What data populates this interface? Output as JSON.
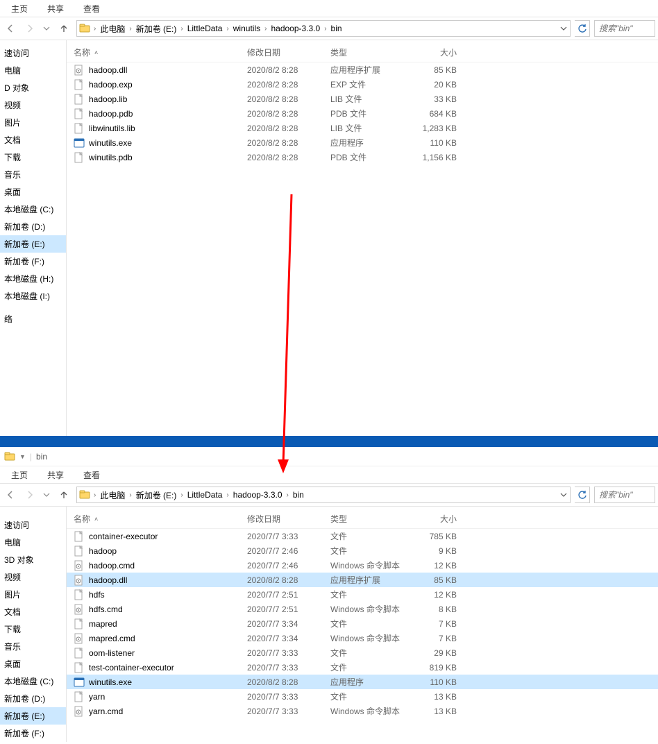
{
  "tabs": {
    "home": "主页",
    "share": "共享",
    "view": "查看"
  },
  "breadcrumb1": [
    "此电脑",
    "新加卷 (E:)",
    "LittleData",
    "winutils",
    "hadoop-3.3.0",
    "bin"
  ],
  "breadcrumb2": [
    "此电脑",
    "新加卷 (E:)",
    "LittleData",
    "hadoop-3.3.0",
    "bin"
  ],
  "search_placeholder": "搜索\"bin\"",
  "columns": {
    "name": "名称",
    "date": "修改日期",
    "type": "类型",
    "size": "大小"
  },
  "sidebar1": [
    "速访问",
    "电脑",
    "D 对象",
    "视频",
    "图片",
    "文档",
    "下载",
    "音乐",
    "桌面",
    "本地磁盘 (C:)",
    "新加卷 (D:)",
    "新加卷 (E:)",
    "新加卷 (F:)",
    "本地磁盘 (H:)",
    "本地磁盘 (I:)",
    "",
    "络"
  ],
  "sidebar1_selected": 11,
  "files1": [
    {
      "icon": "dll",
      "name": "hadoop.dll",
      "date": "2020/8/2 8:28",
      "type": "应用程序扩展",
      "size": "85 KB"
    },
    {
      "icon": "file",
      "name": "hadoop.exp",
      "date": "2020/8/2 8:28",
      "type": "EXP 文件",
      "size": "20 KB"
    },
    {
      "icon": "file",
      "name": "hadoop.lib",
      "date": "2020/8/2 8:28",
      "type": "LIB 文件",
      "size": "33 KB"
    },
    {
      "icon": "file",
      "name": "hadoop.pdb",
      "date": "2020/8/2 8:28",
      "type": "PDB 文件",
      "size": "684 KB"
    },
    {
      "icon": "file",
      "name": "libwinutils.lib",
      "date": "2020/8/2 8:28",
      "type": "LIB 文件",
      "size": "1,283 KB"
    },
    {
      "icon": "exe",
      "name": "winutils.exe",
      "date": "2020/8/2 8:28",
      "type": "应用程序",
      "size": "110 KB"
    },
    {
      "icon": "file",
      "name": "winutils.pdb",
      "date": "2020/8/2 8:28",
      "type": "PDB 文件",
      "size": "1,156 KB"
    }
  ],
  "title2": "bin",
  "sidebar2": [
    "",
    "速访问",
    "电脑",
    "3D 对象",
    "视频",
    "图片",
    "文档",
    "下载",
    "音乐",
    "桌面",
    "本地磁盘 (C:)",
    "新加卷 (D:)",
    "新加卷 (E:)",
    "新加卷 (F:)"
  ],
  "sidebar2_selected": 12,
  "files2": [
    {
      "icon": "file",
      "name": "container-executor",
      "date": "2020/7/7 3:33",
      "type": "文件",
      "size": "785 KB"
    },
    {
      "icon": "file",
      "name": "hadoop",
      "date": "2020/7/7 2:46",
      "type": "文件",
      "size": "9 KB"
    },
    {
      "icon": "cmd",
      "name": "hadoop.cmd",
      "date": "2020/7/7 2:46",
      "type": "Windows 命令脚本",
      "size": "12 KB"
    },
    {
      "icon": "dll",
      "name": "hadoop.dll",
      "date": "2020/8/2 8:28",
      "type": "应用程序扩展",
      "size": "85 KB",
      "sel": true
    },
    {
      "icon": "file",
      "name": "hdfs",
      "date": "2020/7/7 2:51",
      "type": "文件",
      "size": "12 KB"
    },
    {
      "icon": "cmd",
      "name": "hdfs.cmd",
      "date": "2020/7/7 2:51",
      "type": "Windows 命令脚本",
      "size": "8 KB"
    },
    {
      "icon": "file",
      "name": "mapred",
      "date": "2020/7/7 3:34",
      "type": "文件",
      "size": "7 KB"
    },
    {
      "icon": "cmd",
      "name": "mapred.cmd",
      "date": "2020/7/7 3:34",
      "type": "Windows 命令脚本",
      "size": "7 KB"
    },
    {
      "icon": "file",
      "name": "oom-listener",
      "date": "2020/7/7 3:33",
      "type": "文件",
      "size": "29 KB"
    },
    {
      "icon": "file",
      "name": "test-container-executor",
      "date": "2020/7/7 3:33",
      "type": "文件",
      "size": "819 KB"
    },
    {
      "icon": "exe",
      "name": "winutils.exe",
      "date": "2020/8/2 8:28",
      "type": "应用程序",
      "size": "110 KB",
      "sel": true
    },
    {
      "icon": "file",
      "name": "yarn",
      "date": "2020/7/7 3:33",
      "type": "文件",
      "size": "13 KB"
    },
    {
      "icon": "cmd",
      "name": "yarn.cmd",
      "date": "2020/7/7 3:33",
      "type": "Windows 命令脚本",
      "size": "13 KB"
    }
  ]
}
